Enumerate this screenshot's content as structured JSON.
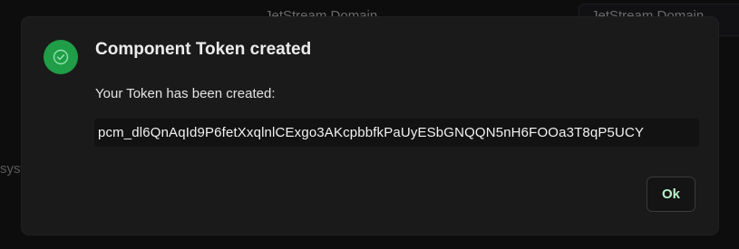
{
  "background": {
    "left_title": "JetStream Domain",
    "right_title": "JetStream Domain",
    "side_text": "syst"
  },
  "dialog": {
    "status_icon": "check-circle-icon",
    "title": "Component Token created",
    "message": "Your Token has been created:",
    "token": "pcm_dl6QnAqId9P6fetXxqlnlCExgo3AKcpbbfkPaUyESbGNQQN5nH6FOOa3T8qP5UCY",
    "ok_label": "Ok"
  },
  "colors": {
    "success": "#1f9d47",
    "ok_text": "#b6f2c9",
    "dialog_bg": "#1a1a1a"
  }
}
